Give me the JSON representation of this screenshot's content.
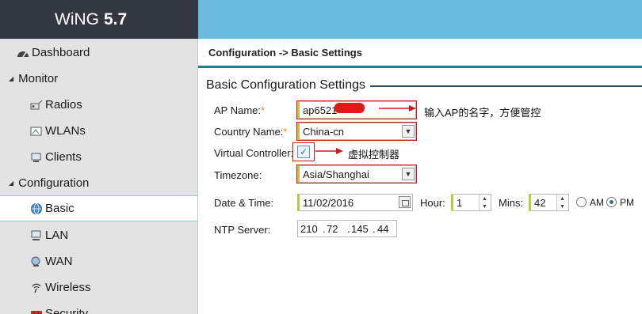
{
  "brand": {
    "name": "WiNG",
    "version": "5.7"
  },
  "sidebar": {
    "items": [
      {
        "label": "Dashboard",
        "icon": "dashboard-gauge-icon"
      },
      {
        "label": "Monitor",
        "icon": "collapse-triangle-icon"
      },
      {
        "label": "Radios",
        "icon": "radio-icon"
      },
      {
        "label": "WLANs",
        "icon": "wlan-icon"
      },
      {
        "label": "Clients",
        "icon": "clients-icon"
      },
      {
        "label": "Configuration",
        "icon": "collapse-triangle-icon"
      },
      {
        "label": "Basic",
        "icon": "globe-icon",
        "selected": true
      },
      {
        "label": "LAN",
        "icon": "lan-icon"
      },
      {
        "label": "WAN",
        "icon": "wan-icon"
      },
      {
        "label": "Wireless",
        "icon": "wireless-icon"
      },
      {
        "label": "Security",
        "icon": "security-icon"
      }
    ]
  },
  "breadcrumb": "Configuration -> Basic Settings",
  "form": {
    "title": "Basic Configuration Settings",
    "ap_name": {
      "label": "AP Name:",
      "required": "*",
      "value": "ap6521"
    },
    "country": {
      "label": "Country Name:",
      "required": "*",
      "value": "China-cn"
    },
    "virtual_controller": {
      "label": "Virtual Controller:",
      "checked": true
    },
    "timezone": {
      "label": "Timezone:",
      "value": "Asia/Shanghai"
    },
    "datetime": {
      "label": "Date & Time:",
      "date": "11/02/2016",
      "hour_label": "Hour:",
      "hour": "1",
      "mins_label": "Mins:",
      "mins": "42",
      "am_label": "AM",
      "pm_label": "PM",
      "selected": "PM"
    },
    "ntp": {
      "label": "NTP Server:",
      "octets": [
        "210",
        "72",
        "145",
        "44"
      ]
    }
  },
  "annotations": {
    "ap_name": "输入AP的名字，方便管控",
    "virtual_controller": "虚拟控制器"
  },
  "colors": {
    "annotation_red": "#d21a1a",
    "accent": "#6bbce0",
    "brand_bg": "#323741"
  }
}
